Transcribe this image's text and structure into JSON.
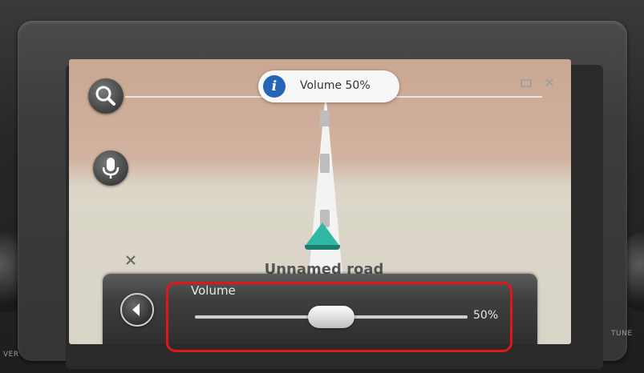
{
  "toast": {
    "icon": "info-icon",
    "icon_glyph": "i",
    "text": "Volume 50%"
  },
  "map": {
    "road_name": "Unnamed road",
    "buttons": [
      {
        "name": "search",
        "icon": "search-icon"
      },
      {
        "name": "voice",
        "icon": "microphone-icon"
      }
    ]
  },
  "volume_panel": {
    "title": "Volume",
    "value_label": "50%",
    "level": 0.5,
    "mute_icon": "speaker-icon"
  },
  "colors": {
    "info_blue": "#2565b8",
    "arrow_teal": "#2fb8a4",
    "highlight_red": "#e0161b"
  }
}
